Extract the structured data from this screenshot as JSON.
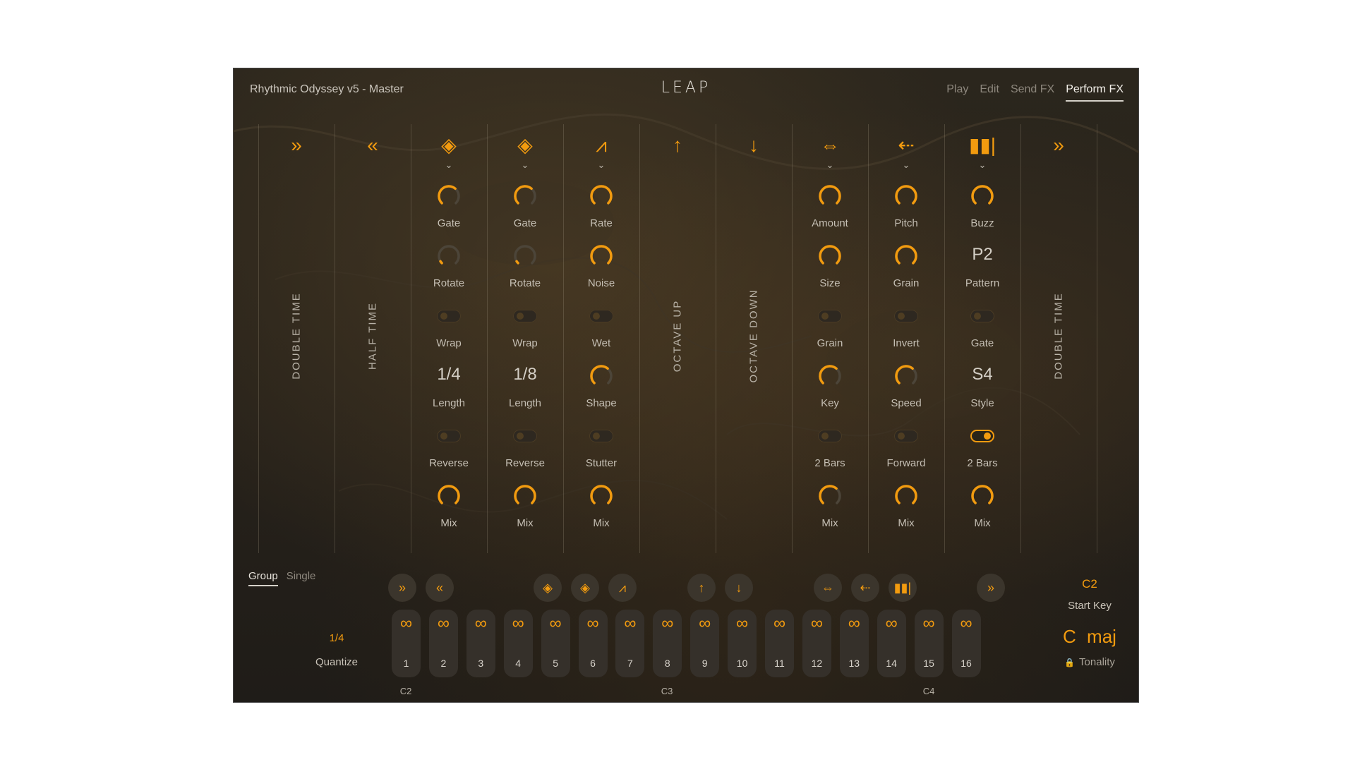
{
  "header": {
    "title": "Rhythmic Odyssey v5 - Master",
    "logo": "LEAP",
    "tabs": [
      "Play",
      "Edit",
      "Send FX",
      "Perform FX"
    ],
    "active_tab": "Perform FX"
  },
  "colors": {
    "accent": "#f29b0f",
    "panel_bg": "#26211a",
    "text": "#c5bfb4"
  },
  "columns": [
    {
      "icon": "double-time-icon",
      "symbol": "»",
      "label": "DOUBLE  TIME"
    },
    {
      "icon": "half-time-icon",
      "symbol": "«",
      "label": "HALF  TIME"
    },
    {
      "icon": "repeater-icon",
      "symbol": "◈",
      "controls": [
        {
          "type": "knob",
          "label": "Gate",
          "value": 0.65
        },
        {
          "type": "knob",
          "label": "Rotate",
          "value": 0.05
        },
        {
          "type": "toggle",
          "label": "Wrap",
          "on": false
        },
        {
          "type": "value",
          "label": "Length",
          "text": "1/4"
        },
        {
          "type": "toggle",
          "label": "Reverse",
          "on": false
        },
        {
          "type": "knob",
          "label": "Mix",
          "value": 1.0
        }
      ]
    },
    {
      "icon": "repeater-icon",
      "symbol": "◈",
      "controls": [
        {
          "type": "knob",
          "label": "Gate",
          "value": 0.65
        },
        {
          "type": "knob",
          "label": "Rotate",
          "value": 0.05
        },
        {
          "type": "toggle",
          "label": "Wrap",
          "on": false
        },
        {
          "type": "value",
          "label": "Length",
          "text": "1/8"
        },
        {
          "type": "toggle",
          "label": "Reverse",
          "on": false
        },
        {
          "type": "knob",
          "label": "Mix",
          "value": 1.0
        }
      ]
    },
    {
      "icon": "glitch-icon",
      "symbol": "⩘",
      "controls": [
        {
          "type": "knob",
          "label": "Rate",
          "value": 1.0
        },
        {
          "type": "knob",
          "label": "Noise",
          "value": 1.0
        },
        {
          "type": "toggle",
          "label": "Wet",
          "on": false
        },
        {
          "type": "knob",
          "label": "Shape",
          "value": 0.65
        },
        {
          "type": "toggle",
          "label": "Stutter",
          "on": false
        },
        {
          "type": "knob",
          "label": "Mix",
          "value": 1.0
        }
      ]
    },
    {
      "icon": "arrow-up-icon",
      "symbol": "↑",
      "label": "OCTAVE  UP"
    },
    {
      "icon": "arrow-down-icon",
      "symbol": "↓",
      "label": "OCTAVE  DOWN"
    },
    {
      "icon": "pitch-mod-icon",
      "symbol": "⇔",
      "controls": [
        {
          "type": "knob",
          "label": "Amount",
          "value": 1.0
        },
        {
          "type": "knob",
          "label": "Size",
          "value": 1.0
        },
        {
          "type": "toggle",
          "label": "Grain",
          "on": false
        },
        {
          "type": "knob",
          "label": "Key",
          "value": 0.65
        },
        {
          "type": "toggle",
          "label": "2 Bars",
          "on": false
        },
        {
          "type": "knob",
          "label": "Mix",
          "value": 0.65
        }
      ]
    },
    {
      "icon": "granular-icon",
      "symbol": "⇠",
      "controls": [
        {
          "type": "knob",
          "label": "Pitch",
          "value": 1.0
        },
        {
          "type": "knob",
          "label": "Grain",
          "value": 1.0
        },
        {
          "type": "toggle",
          "label": "Invert",
          "on": false
        },
        {
          "type": "knob",
          "label": "Speed",
          "value": 0.65
        },
        {
          "type": "toggle",
          "label": "Forward",
          "on": false
        },
        {
          "type": "knob",
          "label": "Mix",
          "value": 1.0
        }
      ]
    },
    {
      "icon": "buzz-icon",
      "symbol": "▮▮|",
      "controls": [
        {
          "type": "knob",
          "label": "Buzz",
          "value": 1.0
        },
        {
          "type": "value",
          "label": "Pattern",
          "text": "P2"
        },
        {
          "type": "toggle",
          "label": "Gate",
          "on": false
        },
        {
          "type": "value",
          "label": "Style",
          "text": "S4"
        },
        {
          "type": "toggle",
          "label": "2 Bars",
          "on": true
        },
        {
          "type": "knob",
          "label": "Mix",
          "value": 1.0
        }
      ]
    },
    {
      "icon": "double-time-icon",
      "symbol": "»",
      "label": "DOUBLE  TIME"
    }
  ],
  "bottom": {
    "mode_tabs": [
      "Group",
      "Single"
    ],
    "active_mode": "Group",
    "quantize_value": "1/4",
    "quantize_label": "Quantize",
    "fx_buttons": [
      {
        "icon": "double-time-icon",
        "symbol": "»"
      },
      {
        "icon": "half-time-icon",
        "symbol": "«"
      },
      {
        "icon": "repeater-icon",
        "symbol": "◈"
      },
      {
        "icon": "repeater-icon",
        "symbol": "◈"
      },
      {
        "icon": "glitch-icon",
        "symbol": "⩘"
      },
      {
        "icon": "arrow-up-icon",
        "symbol": "↑"
      },
      {
        "icon": "arrow-down-icon",
        "symbol": "↓"
      },
      {
        "icon": "pitch-mod-icon",
        "symbol": "⇔"
      },
      {
        "icon": "granular-icon",
        "symbol": "⇠"
      },
      {
        "icon": "buzz-icon",
        "symbol": "▮▮|"
      },
      {
        "icon": "double-time-icon",
        "symbol": "»"
      }
    ],
    "pad_symbol": "∞",
    "pads": [
      "1",
      "2",
      "3",
      "4",
      "5",
      "6",
      "7",
      "8",
      "9",
      "10",
      "11",
      "12",
      "13",
      "14",
      "15",
      "16"
    ],
    "octave_labels": [
      "C2",
      "C3",
      "C4"
    ],
    "start_key_value": "C2",
    "start_key_label": "Start Key",
    "tonality_value": "C maj",
    "tonality_label": "Tonality"
  }
}
